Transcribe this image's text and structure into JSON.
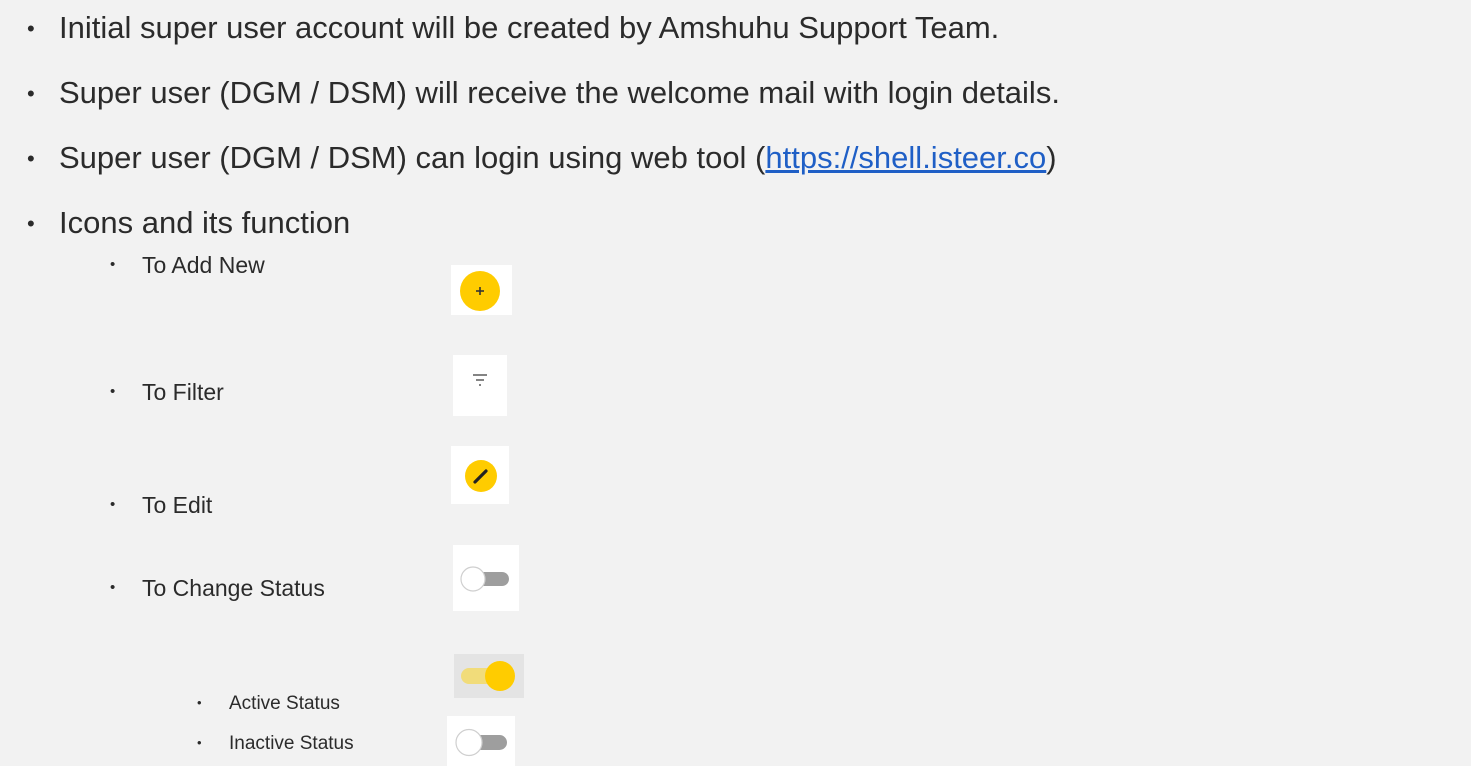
{
  "bullets": {
    "b1": "Initial super user account will be created by Amshuhu Support Team.",
    "b2": "Super user (DGM / DSM) will receive the welcome mail with login details.",
    "b3_prefix": "Super user  (DGM / DSM)  can login using web tool  (",
    "b3_link": "https://shell.isteer.co",
    "b3_suffix": ")",
    "b4": "Icons and its function"
  },
  "icons": {
    "add_new": "To Add New",
    "filter": "To Filter",
    "edit": "To Edit",
    "change_status": "To Change Status",
    "active_status": "Active Status",
    "inactive_status": "Inactive Status"
  },
  "bullet_char": "•",
  "colors": {
    "accent_yellow": "#ffcc00",
    "link_blue": "#1f5fc6",
    "text": "#2b2b2b",
    "background": "#f2f2f2"
  },
  "icon_names": {
    "add": "plus-circle-icon",
    "filter": "filter-icon",
    "edit": "pencil-circle-icon",
    "toggle": "toggle-icon"
  }
}
